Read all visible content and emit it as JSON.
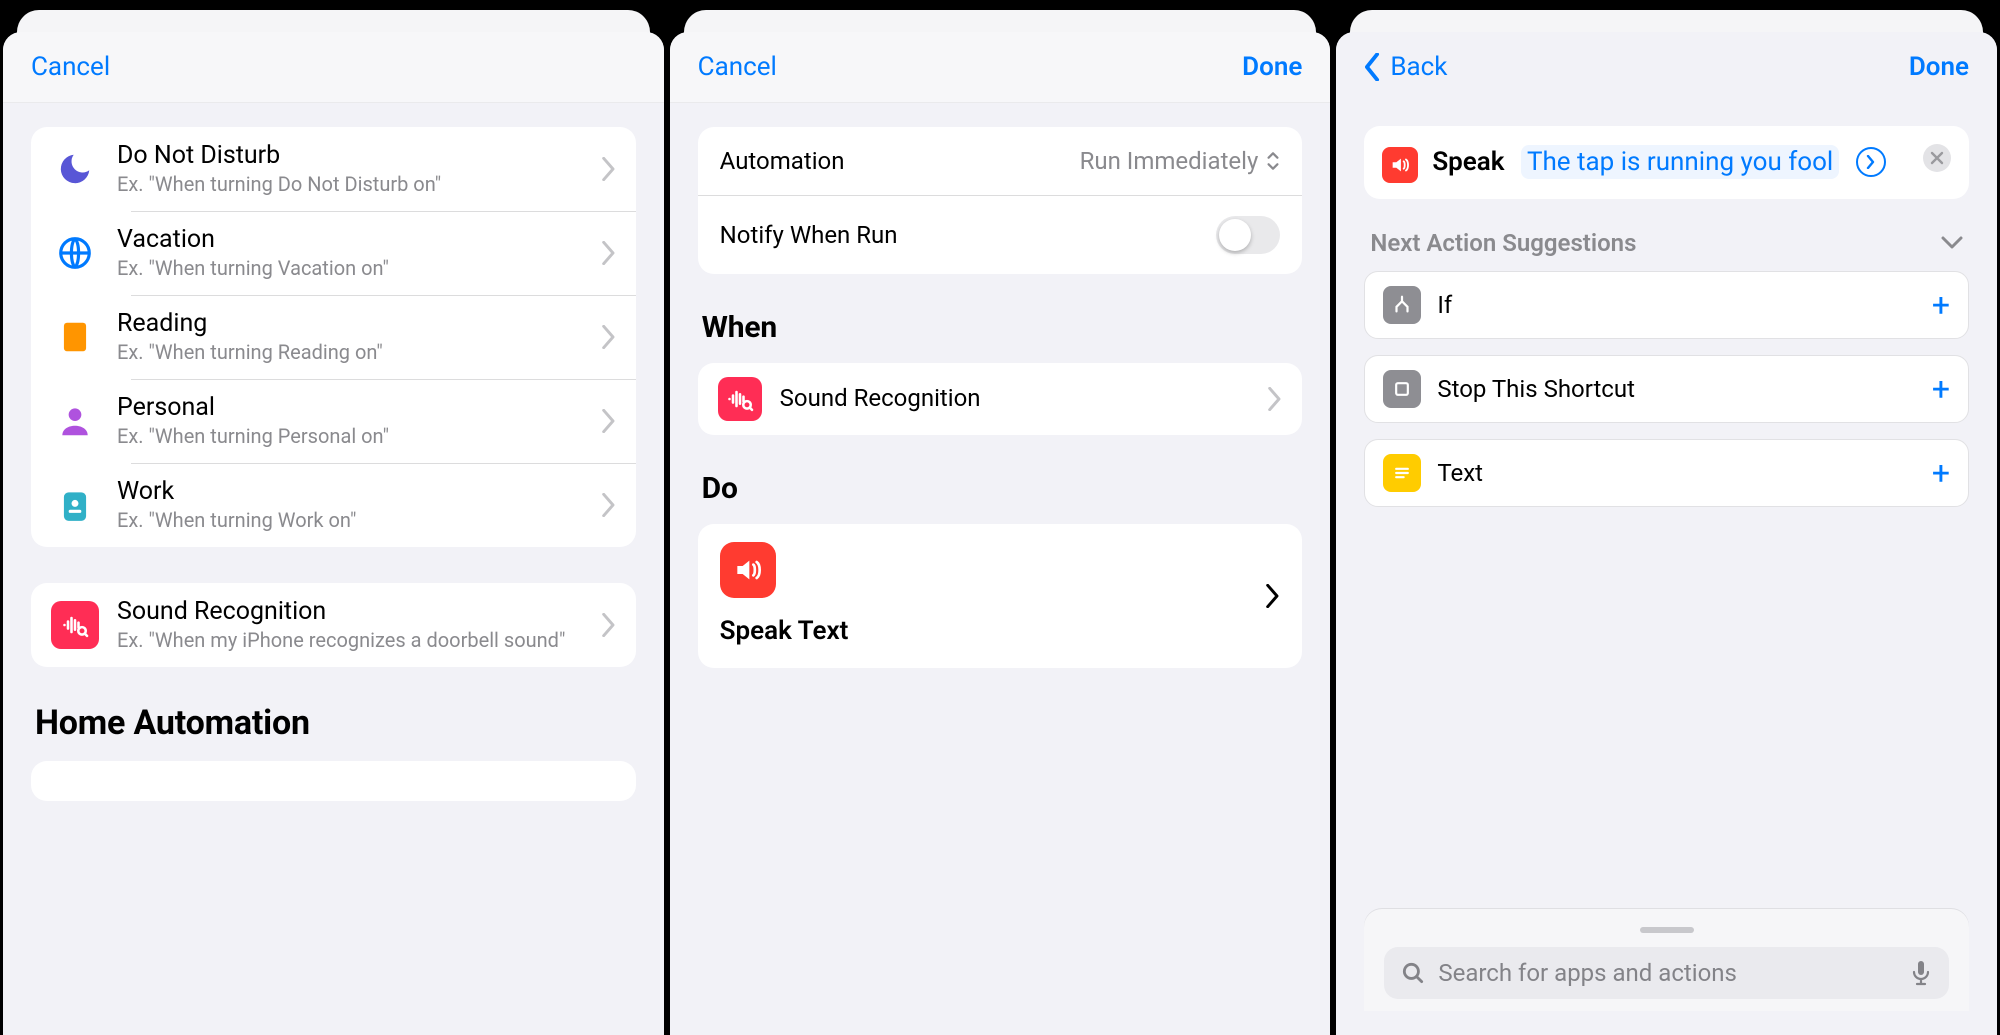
{
  "panel1": {
    "nav": {
      "cancel": "Cancel"
    },
    "focus_items": [
      {
        "title": "Do Not Disturb",
        "subtitle": "Ex. \"When turning Do Not Disturb on\"",
        "icon": "moon"
      },
      {
        "title": "Vacation",
        "subtitle": "Ex. \"When turning Vacation on\"",
        "icon": "globe"
      },
      {
        "title": "Reading",
        "subtitle": "Ex. \"When turning Reading on\"",
        "icon": "book"
      },
      {
        "title": "Personal",
        "subtitle": "Ex. \"When turning Personal on\"",
        "icon": "person"
      },
      {
        "title": "Work",
        "subtitle": "Ex. \"When turning Work on\"",
        "icon": "badge"
      }
    ],
    "sound_item": {
      "title": "Sound Recognition",
      "subtitle": "Ex. \"When my iPhone recognizes a doorbell sound\""
    },
    "home_header": "Home Automation"
  },
  "panel2": {
    "nav": {
      "cancel": "Cancel",
      "done": "Done"
    },
    "automation_label": "Automation",
    "automation_value": "Run Immediately",
    "notify_label": "Notify When Run",
    "notify_on": false,
    "when_header": "When",
    "when_item": "Sound Recognition",
    "do_header": "Do",
    "do_item": "Speak Text"
  },
  "panel3": {
    "nav": {
      "back": "Back",
      "done": "Done"
    },
    "speak": {
      "verb": "Speak",
      "arg": "The tap is running you fool"
    },
    "suggest_header": "Next Action Suggestions",
    "suggestions": [
      {
        "label": "If",
        "icon": "if"
      },
      {
        "label": "Stop This Shortcut",
        "icon": "stop"
      },
      {
        "label": "Text",
        "icon": "text"
      }
    ],
    "search_placeholder": "Search for apps and actions"
  }
}
